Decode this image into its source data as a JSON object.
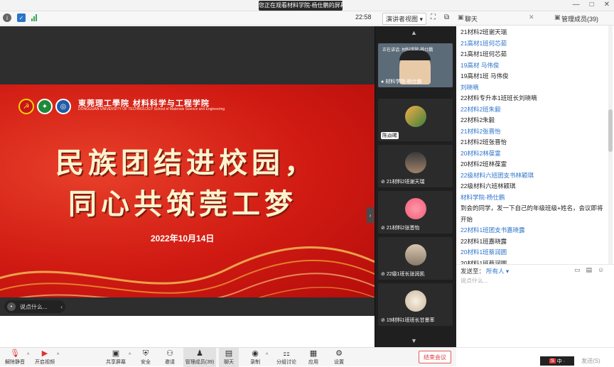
{
  "top": {
    "share_notice": "您正在观看材料学院-杨仕鹏的屏幕",
    "win_controls": [
      "—",
      "□",
      "✕"
    ]
  },
  "meeting": {
    "timer": "22:58",
    "view_mode": "演讲者视图 ▾"
  },
  "slide": {
    "school_cn": "東莞理工學院 材料科学与工程学院",
    "school_en": "DONGGUAN UNIVERSITY OF TECHNOLOGY   School of Materials Science and Engineering",
    "title_line1": "民族团结进校园，",
    "title_line2": "同心共筑莞工梦",
    "date": "2022年10月14日"
  },
  "overlay": {
    "say_something": "说点什么..."
  },
  "speaker": {
    "status": "正在讲话: 材料学院-杨仕鹏",
    "label": "材料学院-杨仕鹏"
  },
  "participants": [
    {
      "name": "陈焱晞"
    },
    {
      "name": "21材料2班谢天瑞"
    },
    {
      "name": "21材料2张晋怡"
    },
    {
      "name": "22级1班长张润凯"
    },
    {
      "name": "19材料1班班长甘墨率"
    }
  ],
  "chat": {
    "tab_chat": "聊天",
    "tab_members": "管理成员(39)",
    "messages": [
      {
        "kind": "text",
        "text": "21材料2班谢天瑞"
      },
      {
        "kind": "name",
        "text": "21高材1班何芯茹"
      },
      {
        "kind": "text",
        "text": "21高材1班何芯茹"
      },
      {
        "kind": "name",
        "text": "19高材 马伟俊"
      },
      {
        "kind": "text",
        "text": "19高材1班 马伟俊"
      },
      {
        "kind": "name",
        "text": "刘晓嘀"
      },
      {
        "kind": "text",
        "text": "22材料专升本1班班长刘晓嘀"
      },
      {
        "kind": "name",
        "text": "22材料2班朱毅"
      },
      {
        "kind": "text",
        "text": "22材料2朱毅"
      },
      {
        "kind": "name",
        "text": "21材料2张晋怡"
      },
      {
        "kind": "text",
        "text": "21材料2班张晋怡"
      },
      {
        "kind": "name",
        "text": "20材料2林葆霊"
      },
      {
        "kind": "text",
        "text": "20材料2班林葆霊"
      },
      {
        "kind": "name",
        "text": "22级材料六班团支书林颖琪"
      },
      {
        "kind": "text",
        "text": "22级材料六班林颖琪"
      },
      {
        "kind": "name",
        "text": "材料学院-杨仕鹏"
      },
      {
        "kind": "text",
        "text": "到会的同学，发一下自己的年级班级+姓名，会议即将开始"
      },
      {
        "kind": "name",
        "text": "22材料1班团支书嘉晓露"
      },
      {
        "kind": "text",
        "text": "22材料1班嘉晓露"
      },
      {
        "kind": "name",
        "text": "20材料1班蔡润圆"
      },
      {
        "kind": "text",
        "text": "20材料1班蔡润圆"
      }
    ],
    "send_to_label": "发送至：",
    "send_to_value": "所有人 ▾",
    "input_placeholder": "说点什么...",
    "send_button": "发送(S)"
  },
  "controls": {
    "mute": "解除静音",
    "video": "开启视频",
    "share": "共享屏幕",
    "security": "安全",
    "invite": "邀请",
    "members": "管理成员(39)",
    "chat": "聊天",
    "record": "录制",
    "breakout": "分组讨论",
    "apps": "应用",
    "settings": "设置",
    "leave": "结束会议"
  },
  "ime": {
    "label": "S",
    "extra": "中 ·"
  }
}
